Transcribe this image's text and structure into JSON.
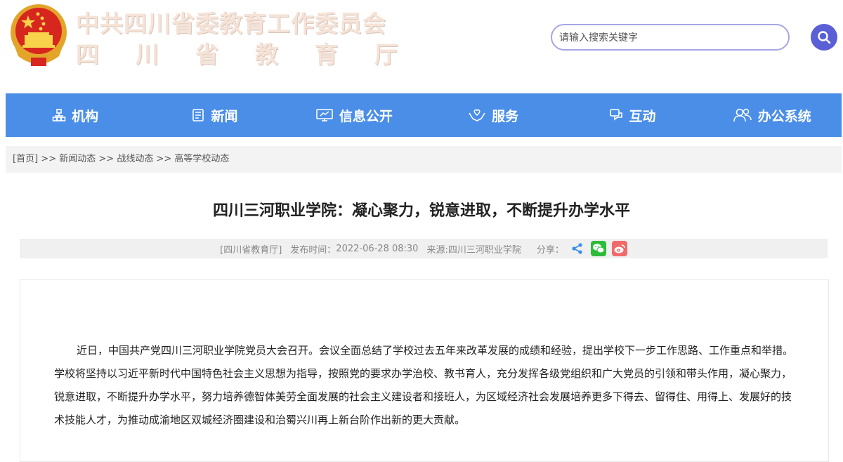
{
  "header": {
    "site_name_line1": "中共四川省委教育工作委员会",
    "site_name_line2": "四川省教育厅",
    "search_placeholder": "请输入搜索关键字"
  },
  "nav": {
    "items": [
      {
        "label": "机构",
        "icon": "org-icon"
      },
      {
        "label": "新闻",
        "icon": "news-icon"
      },
      {
        "label": "信息公开",
        "icon": "monitor-icon"
      },
      {
        "label": "服务",
        "icon": "service-hands-icon"
      },
      {
        "label": "互动",
        "icon": "chat-icon"
      },
      {
        "label": "办公系统",
        "icon": "users-icon"
      }
    ]
  },
  "breadcrumb": {
    "items": [
      "[首页]",
      "新闻动态",
      "战线动态",
      "高等学校动态"
    ],
    "separator": ">>"
  },
  "article": {
    "title": "四川三河职业学院：凝心聚力，锐意进取，不断提升办学水平",
    "source_org": "[四川省教育厅]",
    "publish_label": "发布时间：",
    "publish_time": "2022-06-28 08:30",
    "source": "来源:四川三河职业学院",
    "share_label": "分享：",
    "body": "近日，中国共产党四川三河职业学院党员大会召开。会议全面总结了学校过去五年来改革发展的成绩和经验，提出学校下一步工作思路、工作重点和举措。学校将坚持以习近平新时代中国特色社会主义思想为指导，按照党的要求办学治校、教书育人，充分发挥各级党组织和广大党员的引领和带头作用，凝心聚力，锐意进取，不断提升办学水平，努力培养德智体美劳全面发展的社会主义建设者和接班人，为区域经济社会发展培养更多下得去、留得住、用得上、发展好的技术技能人才，为推动成渝地区双城经济圈建设和治蜀兴川再上新台阶作出新的更大贡献。"
  },
  "colors": {
    "nav_bg": "#4a8ee8",
    "search_btn": "#5b5fd6",
    "wechat": "#2dbb3a",
    "weibo": "#f06a6a",
    "share_blue": "#3a8ee6"
  }
}
